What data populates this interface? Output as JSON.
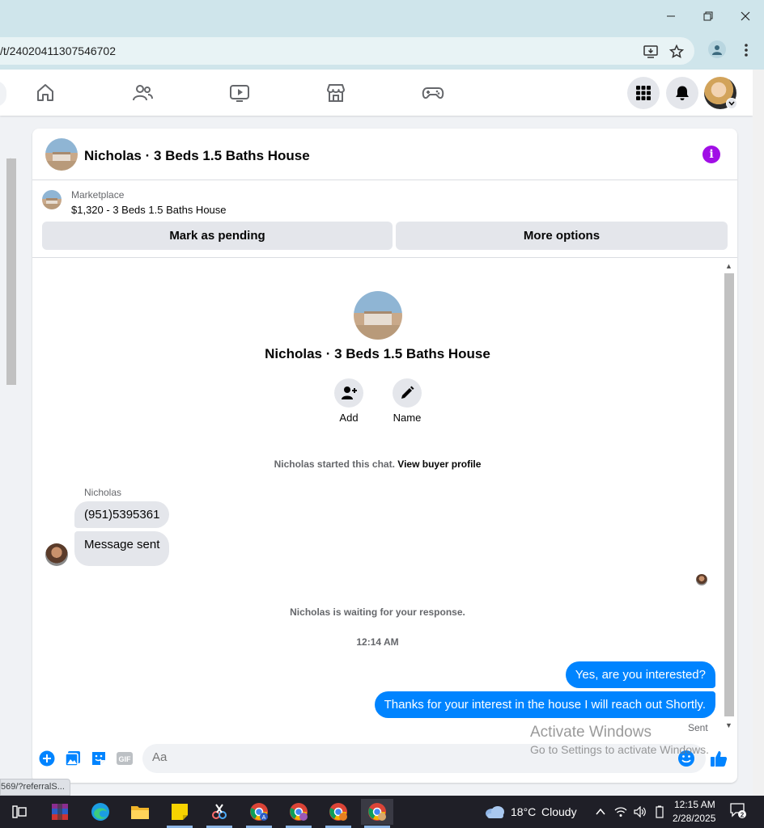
{
  "browser": {
    "url": "/t/24020411307546702",
    "status_url": "569/?referralS..."
  },
  "chat": {
    "title": "Nicholas · 3 Beds 1.5 Baths House",
    "listing": {
      "label": "Marketplace",
      "price_title": "$1,320 - 3 Beds 1.5 Baths House"
    },
    "buttons": {
      "mark_pending": "Mark as pending",
      "more_options": "More options"
    },
    "profile": {
      "name": "Nicholas · 3 Beds 1.5 Baths House",
      "add_label": "Add",
      "name_label": "Name"
    },
    "started_text": "Nicholas started this chat.",
    "buyer_profile_link": "View buyer profile",
    "sender": "Nicholas",
    "incoming": [
      "(951)5395361",
      "Message sent"
    ],
    "waiting_text": "Nicholas is waiting for your response.",
    "timestamp": "12:14 AM",
    "outgoing": [
      "Yes, are you interested?",
      "Thanks for your interest in the house I will reach out Shortly."
    ],
    "sent_status": "Sent",
    "composer_placeholder": "Aa",
    "gif_label": "GIF"
  },
  "watermark": {
    "line1": "Activate Windows",
    "line2": "Go to Settings to activate Windows."
  },
  "taskbar": {
    "weather_temp": "18°C",
    "weather_desc": "Cloudy",
    "time": "12:15 AM",
    "date": "2/28/2025",
    "notification_count": "2"
  },
  "colors": {
    "messenger_blue": "#0084ff",
    "info_purple": "#a10ee6",
    "bubble_gray": "#e4e6eb"
  }
}
